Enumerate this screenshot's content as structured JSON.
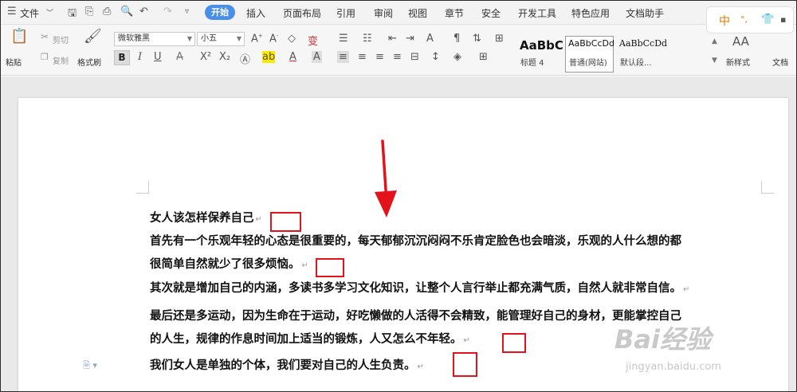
{
  "menubar": {
    "file": "文件",
    "tabs": [
      "开始",
      "插入",
      "页面布局",
      "引用",
      "审阅",
      "视图",
      "章节",
      "安全",
      "开发工具",
      "特色应用",
      "文档助手"
    ]
  },
  "toolbar": {
    "paste": "粘贴",
    "cut": "剪切",
    "copy": "复制",
    "format_painter": "格式刷",
    "font_name": "微软雅黑",
    "font_size": "小五",
    "bold": "B",
    "italic": "I",
    "underline": "U",
    "styles": [
      {
        "preview": "AaBbC",
        "label": "标题 4"
      },
      {
        "preview": "AaBbCcDd",
        "label": "普通(网站)"
      },
      {
        "preview": "AaBbCcDd",
        "label": "默认段..."
      }
    ],
    "new_style_icon": "AA",
    "new_style": "新样式",
    "doc_assistant": "文档"
  },
  "langbar": {
    "lang": "中"
  },
  "document": {
    "paragraphs": [
      "女人该怎样保养自己",
      "首先有一个乐观年轻的心态是很重要的，每天郁郁沉沉闷闷不乐肯定脸色也会暗淡，乐观的人什么想的都",
      "很简单自然就少了很多烦恼。",
      " 其次就是增加自己的内涵，多读书多学习文化知识，让整个人言行举止都充满气质，自然人就非常自信。",
      "最后还是多运动，因为生命在于运动，好吃懒做的人活得不会精致，能管理好自己的身材，更能掌控自己",
      "的人生，规律的作息时间加上适当的锻炼，人又怎么不年轻。",
      "我们女人是单独的个体，我们要对自己的人生负责。"
    ],
    "paragraph_mark": "↵"
  },
  "watermark": {
    "brand": "Bai经验",
    "url": "jingyan.baidu.com"
  },
  "colors": {
    "accent": "#4a8fe7",
    "annotation_red": "#e4131b"
  }
}
